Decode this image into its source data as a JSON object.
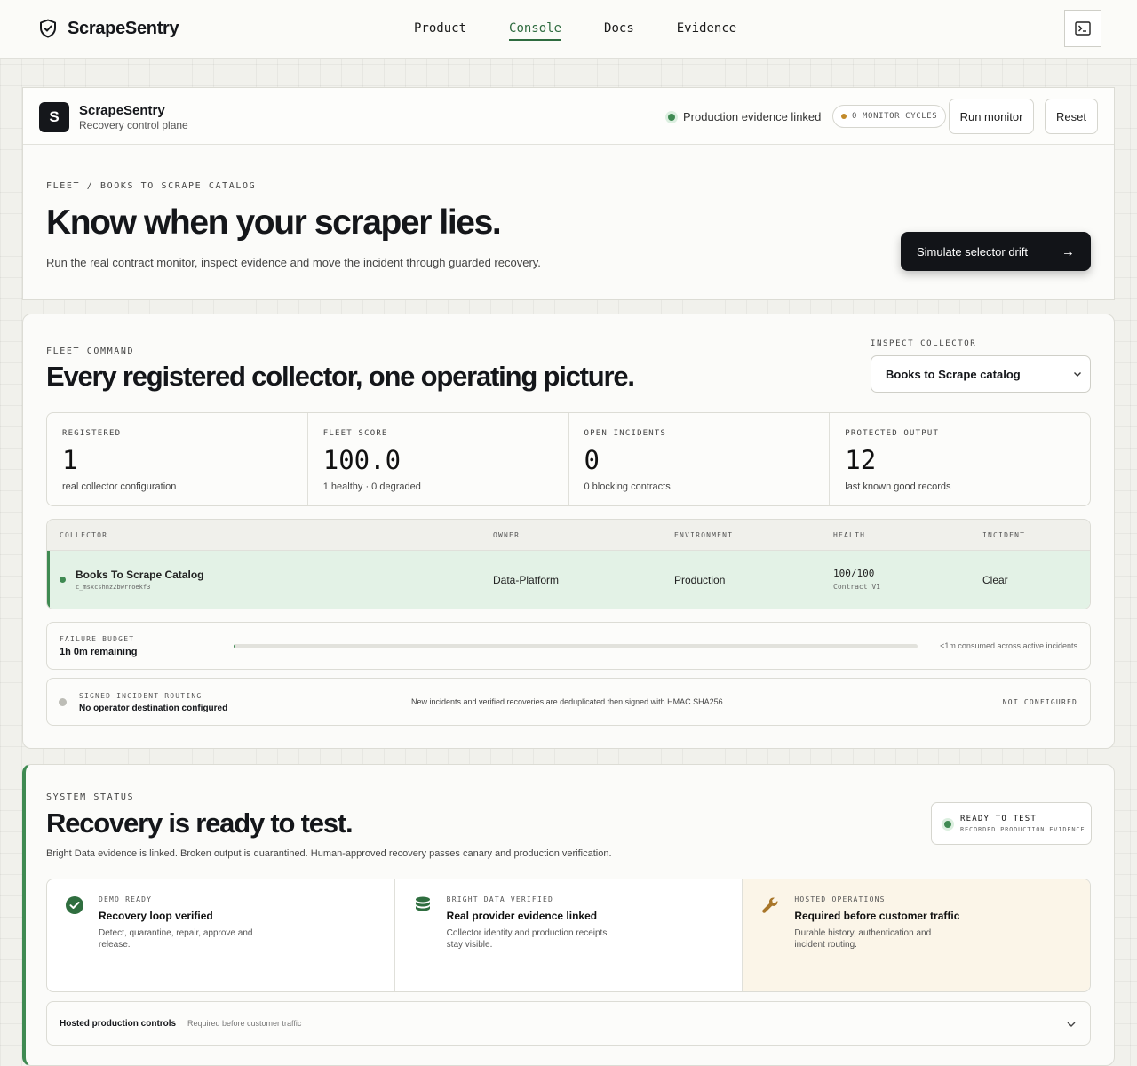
{
  "nav": {
    "brand": "ScrapeSentry",
    "links": [
      "Product",
      "Console",
      "Docs",
      "Evidence"
    ],
    "active": "Console"
  },
  "header": {
    "logo_letter": "S",
    "app_name": "ScrapeSentry",
    "app_subtitle": "Recovery control plane",
    "evidence_status": "Production evidence linked",
    "monitor_cycles": "0 MONITOR CYCLES",
    "run_monitor": "Run monitor",
    "reset": "Reset"
  },
  "hero": {
    "breadcrumb": "FLEET / BOOKS TO SCRAPE CATALOG",
    "title": "Know when your scraper lies.",
    "description": "Run the real contract monitor, inspect evidence and move the incident through guarded recovery.",
    "cta": "Simulate selector drift",
    "cta_arrow": "→"
  },
  "fleet": {
    "eyebrow": "FLEET COMMAND",
    "title": "Every registered collector, one operating picture.",
    "inspect_label": "INSPECT COLLECTOR",
    "inspect_value": "Books to Scrape catalog",
    "stats": [
      {
        "label": "REGISTERED",
        "value": "1",
        "note": "real collector configuration"
      },
      {
        "label": "FLEET SCORE",
        "value": "100.0",
        "note": "1 healthy · 0 degraded"
      },
      {
        "label": "OPEN INCIDENTS",
        "value": "0",
        "note": "0 blocking contracts"
      },
      {
        "label": "PROTECTED OUTPUT",
        "value": "12",
        "note": "last known good records"
      }
    ],
    "table": {
      "headers": [
        "COLLECTOR",
        "OWNER",
        "ENVIRONMENT",
        "HEALTH",
        "INCIDENT"
      ],
      "row": {
        "name": "Books To Scrape Catalog",
        "id": "c_msxcshnz2bwrroekf3",
        "owner": "Data-Platform",
        "environment": "Production",
        "health": "100/100",
        "contract": "Contract V1",
        "incident": "Clear"
      }
    },
    "budget": {
      "label": "FAILURE BUDGET",
      "value": "1h 0m remaining",
      "note": "<1m consumed across active incidents",
      "consumed_fraction": 0.003
    },
    "routing": {
      "label": "SIGNED INCIDENT ROUTING",
      "value": "No operator destination configured",
      "description": "New incidents and verified recoveries are deduplicated then signed with HMAC SHA256.",
      "status": "NOT CONFIGURED"
    }
  },
  "status": {
    "eyebrow": "SYSTEM STATUS",
    "title": "Recovery is ready to test.",
    "description": "Bright Data evidence is linked. Broken output is quarantined. Human-approved recovery passes canary and production verification.",
    "pill_title": "READY TO TEST",
    "pill_sub": "RECORDED PRODUCTION EVIDENCE",
    "cards": [
      {
        "eyebrow": "DEMO READY",
        "title": "Recovery loop verified",
        "desc": "Detect, quarantine, repair, approve and release.",
        "icon": "check-circle-icon"
      },
      {
        "eyebrow": "BRIGHT DATA VERIFIED",
        "title": "Real provider evidence linked",
        "desc": "Collector identity and production receipts stay visible.",
        "icon": "database-icon"
      },
      {
        "eyebrow": "HOSTED OPERATIONS",
        "title": "Required before customer traffic",
        "desc": "Durable history, authentication and incident routing.",
        "icon": "wrench-icon"
      }
    ],
    "hosted": {
      "title": "Hosted production controls",
      "note": "Required before customer traffic"
    }
  },
  "colors": {
    "accent_green": "#3f8a52",
    "row_highlight": "#e3f2e6",
    "warning_bg": "#fbf5e8",
    "dark": "#121418"
  }
}
